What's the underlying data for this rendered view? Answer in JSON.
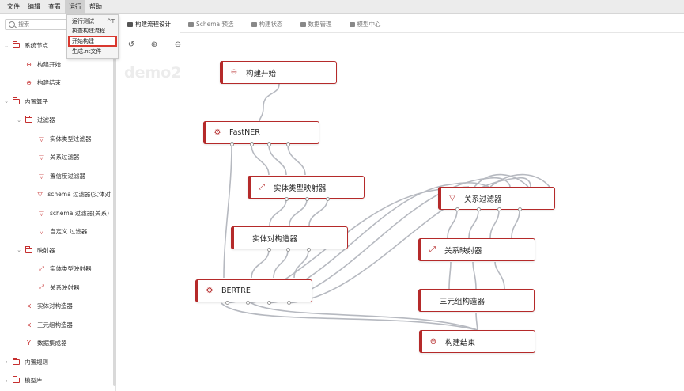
{
  "menubar": {
    "items": [
      "文件",
      "编辑",
      "查看",
      "运行",
      "帮助"
    ],
    "active_index": 3
  },
  "run_menu": {
    "items": [
      {
        "label": "运行测试",
        "shortcut": "^T"
      },
      {
        "label": "执查构建流程",
        "shortcut": ""
      },
      {
        "label": "开始构建",
        "shortcut": ""
      },
      {
        "label": "生成.nt文件",
        "shortcut": ""
      }
    ],
    "highlight_index": 2
  },
  "search": {
    "placeholder": "搜索"
  },
  "tree": {
    "items": [
      {
        "label": "系统节点",
        "icon": "folder-icon",
        "arrow": "⌄",
        "indent": 0
      },
      {
        "label": "构建开始",
        "icon": "start-icon",
        "arrow": "",
        "indent": 1
      },
      {
        "label": "构建结束",
        "icon": "end-icon",
        "arrow": "",
        "indent": 1
      },
      {
        "label": "内置算子",
        "icon": "folder-icon",
        "arrow": "⌄",
        "indent": 0
      },
      {
        "label": "过滤器",
        "icon": "folder-icon",
        "arrow": "⌄",
        "indent": 1
      },
      {
        "label": "实体类型过滤器",
        "icon": "filter-icon",
        "arrow": "",
        "indent": 2
      },
      {
        "label": "关系过滤器",
        "icon": "filter-icon",
        "arrow": "",
        "indent": 2
      },
      {
        "label": "置信度过滤器",
        "icon": "filter-icon",
        "arrow": "",
        "indent": 2
      },
      {
        "label": "schema 过滤器(实体对",
        "icon": "filter-icon",
        "arrow": "",
        "indent": 2
      },
      {
        "label": "schema 过滤器(关系)",
        "icon": "filter-icon",
        "arrow": "",
        "indent": 2
      },
      {
        "label": "自定义 过滤器",
        "icon": "filter-icon",
        "arrow": "",
        "indent": 2
      },
      {
        "label": "映射器",
        "icon": "folder-icon",
        "arrow": "⌄",
        "indent": 1
      },
      {
        "label": "实体类型映射器",
        "icon": "mapper-icon",
        "arrow": "",
        "indent": 2
      },
      {
        "label": "关系映射器",
        "icon": "mapper-icon",
        "arrow": "",
        "indent": 2
      },
      {
        "label": "实体对构造器",
        "icon": "share-icon",
        "arrow": "",
        "indent": 1
      },
      {
        "label": "三元组构造器",
        "icon": "share-icon",
        "arrow": "",
        "indent": 1
      },
      {
        "label": "数据集成器",
        "icon": "merge-icon",
        "arrow": "",
        "indent": 1
      },
      {
        "label": "内置规则",
        "icon": "folder-icon",
        "arrow": "›",
        "indent": 0
      },
      {
        "label": "模型库",
        "icon": "folder-icon",
        "arrow": "›",
        "indent": 0
      }
    ]
  },
  "tabs": [
    {
      "label": "构建流程设计",
      "active": true
    },
    {
      "label": "Schema 预选",
      "active": false
    },
    {
      "label": "构建状态",
      "active": false
    },
    {
      "label": "数据管理",
      "active": false
    },
    {
      "label": "模型中心",
      "active": false
    }
  ],
  "toolbar": {
    "icons": [
      "undo-icon",
      "zoom-in-icon",
      "zoom-out-icon"
    ]
  },
  "canvas": {
    "watermark": "demo2",
    "nodes": [
      {
        "id": "start",
        "label": "构建开始",
        "icon": "start-icon"
      },
      {
        "id": "fastner",
        "label": "FastNER",
        "icon": "chip-icon"
      },
      {
        "id": "etmapper",
        "label": "实体类型映射器",
        "icon": "mapper-icon"
      },
      {
        "id": "pairbuilder",
        "label": "实体对构造器",
        "icon": ""
      },
      {
        "id": "bertre",
        "label": "BERTRE",
        "icon": "chip-icon"
      },
      {
        "id": "relfilter",
        "label": "关系过滤器",
        "icon": "filter-icon"
      },
      {
        "id": "relmapper",
        "label": "关系映射器",
        "icon": "mapper-icon"
      },
      {
        "id": "triplebuilder",
        "label": "三元组构造器",
        "icon": ""
      },
      {
        "id": "end",
        "label": "构建结束",
        "icon": "end-icon"
      }
    ],
    "edges": [
      [
        "start",
        "fastner"
      ],
      [
        "fastner",
        "etmapper"
      ],
      [
        "fastner",
        "bertre"
      ],
      [
        "etmapper",
        "pairbuilder"
      ],
      [
        "pairbuilder",
        "bertre"
      ],
      [
        "bertre",
        "relfilter"
      ],
      [
        "relfilter",
        "relmapper"
      ],
      [
        "relmapper",
        "triplebuilder"
      ],
      [
        "triplebuilder",
        "end"
      ],
      [
        "bertre",
        "end"
      ]
    ]
  },
  "colors": {
    "accent": "#b52a2a",
    "highlight": "#d9382f",
    "edge": "#b6b9c0"
  }
}
